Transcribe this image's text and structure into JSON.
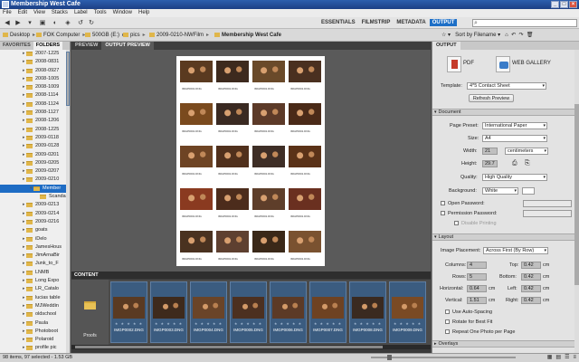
{
  "window": {
    "title": "Membership West Cafe"
  },
  "menu": [
    "File",
    "Edit",
    "View",
    "Stacks",
    "Label",
    "Tools",
    "Window",
    "Help"
  ],
  "workspaces": [
    "ESSENTIALS",
    "FILMSTRIP",
    "METADATA",
    "OUTPUT"
  ],
  "search": {
    "placeholder": ""
  },
  "path": {
    "items": [
      "Desktop",
      "FOK Computer",
      "500GB (E:)",
      "pics",
      "2009-0210-NWFilm",
      "Membership West Cafe"
    ]
  },
  "sort": {
    "label": "Sort by Filename"
  },
  "left_panel": {
    "tabs": [
      "FAVORITES",
      "FOLDERS"
    ],
    "tree": [
      {
        "label": "2007-1225",
        "depth": 1
      },
      {
        "label": "2008-0831",
        "depth": 1
      },
      {
        "label": "2008-0927",
        "depth": 1
      },
      {
        "label": "2008-1005",
        "depth": 1
      },
      {
        "label": "2008-1009",
        "depth": 1
      },
      {
        "label": "2008-1114",
        "depth": 1
      },
      {
        "label": "2008-1124",
        "depth": 1
      },
      {
        "label": "2008-1127",
        "depth": 1
      },
      {
        "label": "2008-1206",
        "depth": 1
      },
      {
        "label": "2008-1225",
        "depth": 1
      },
      {
        "label": "2009-0118",
        "depth": 1
      },
      {
        "label": "2009-0128",
        "depth": 1
      },
      {
        "label": "2009-0201",
        "depth": 1
      },
      {
        "label": "2009-0205",
        "depth": 1
      },
      {
        "label": "2009-0207",
        "depth": 1
      },
      {
        "label": "2009-0210",
        "depth": 1
      },
      {
        "label": "Member",
        "depth": 2,
        "selected": true
      },
      {
        "label": "Scanda",
        "depth": 3
      },
      {
        "label": "2009-0213",
        "depth": 1
      },
      {
        "label": "2009-0214",
        "depth": 1
      },
      {
        "label": "2009-0216",
        "depth": 1
      },
      {
        "label": "goats",
        "depth": 1
      },
      {
        "label": "iDelo",
        "depth": 1
      },
      {
        "label": "JamesHous",
        "depth": 1
      },
      {
        "label": "JimArnaBir",
        "depth": 1
      },
      {
        "label": "Junk_to_F",
        "depth": 1
      },
      {
        "label": "LNMB",
        "depth": 1
      },
      {
        "label": "Long Expo",
        "depth": 1
      },
      {
        "label": "LR_Catalo",
        "depth": 1
      },
      {
        "label": "lucias table",
        "depth": 1
      },
      {
        "label": "MJWeddin",
        "depth": 1
      },
      {
        "label": "oldschool",
        "depth": 1
      },
      {
        "label": "Paula",
        "depth": 1
      },
      {
        "label": "Photoboot",
        "depth": 1
      },
      {
        "label": "Polaroid",
        "depth": 1
      },
      {
        "label": "profile pic",
        "depth": 1
      },
      {
        "label": "PurfinBull",
        "depth": 1
      }
    ]
  },
  "center": {
    "tabs": [
      "PREVIEW",
      "OUTPUT PREVIEW"
    ],
    "sheet_caption": "IMGP0001.DNG",
    "sheet_images": [
      "#5a3a20",
      "#3d2a1e",
      "#6a4a2a",
      "#4a3020",
      "#7a4a1e",
      "#3a2a22",
      "#5c3a28",
      "#4a2a18",
      "#6e4424",
      "#50301c",
      "#3e2e26",
      "#5a3218",
      "#8a3a20",
      "#4c2c1c",
      "#5e3e2a",
      "#6a3020",
      "#4a3220",
      "#5e4030",
      "#3a2818",
      "#7a5230"
    ]
  },
  "content": {
    "tab": "CONTENT",
    "proof_label": "Proofs",
    "thumbs": [
      {
        "name": "IMGP0002.DNG",
        "color": "#5a3a22"
      },
      {
        "name": "IMGP0003.DNG",
        "color": "#3e2a1c"
      },
      {
        "name": "IMGP0004.DNG",
        "color": "#6a4428"
      },
      {
        "name": "IMGP0005.DNG",
        "color": "#4c3020"
      },
      {
        "name": "IMGP0006.DNG",
        "color": "#5c3a26"
      },
      {
        "name": "IMGP0007.DNG",
        "color": "#6e4222"
      },
      {
        "name": "IMGP0008.DNG",
        "color": "#3a2a20"
      },
      {
        "name": "IMGP0009.DNG",
        "color": "#7a4a24"
      }
    ],
    "stars": "★ ★ ★ ★ ★"
  },
  "output_panel": {
    "tab": "OUTPUT",
    "pdf_label": "PDF",
    "web_gallery_label": "WEB GALLERY",
    "template_label": "Template:",
    "template_value": "4*5 Contact Sheet",
    "refresh_label": "Refresh Preview",
    "document": {
      "title": "Document",
      "page_preset_label": "Page Preset:",
      "page_preset_value": "International Paper",
      "size_label": "Size:",
      "size_value": "A4",
      "width_label": "Width:",
      "width_value": "21",
      "unit_value": "centimeters",
      "height_label": "Height:",
      "height_value": "29.7",
      "quality_label": "Quality:",
      "quality_value": "High Quality",
      "background_label": "Background:",
      "background_value": "White",
      "open_password_label": "Open Password:",
      "permission_password_label": "Permission Password:",
      "disable_printing_label": "Disable Printing"
    },
    "layout": {
      "title": "Layout",
      "image_placement_label": "Image Placement:",
      "image_placement_value": "Across First (By Row)",
      "columns_label": "Columns:",
      "columns_value": "4",
      "rows_label": "Rows:",
      "rows_value": "5",
      "horizontal_label": "Horizontal:",
      "horizontal_value": "0.64",
      "vertical_label": "Vertical:",
      "vertical_value": "1.51",
      "top_label": "Top:",
      "top_value": "0.42",
      "bottom_label": "Bottom:",
      "bottom_value": "0.42",
      "left_label": "Left:",
      "left_value": "0.42",
      "right_label": "Right:",
      "right_value": "0.42",
      "unit": "cm",
      "auto_spacing_label": "Use Auto-Spacing",
      "rotate_label": "Rotate for Best Fit",
      "repeat_label": "Repeat One Photo per Page"
    },
    "overlays_title": "Overlays"
  },
  "status": {
    "text": "98 items, 97 selected - 1.53 GB"
  }
}
